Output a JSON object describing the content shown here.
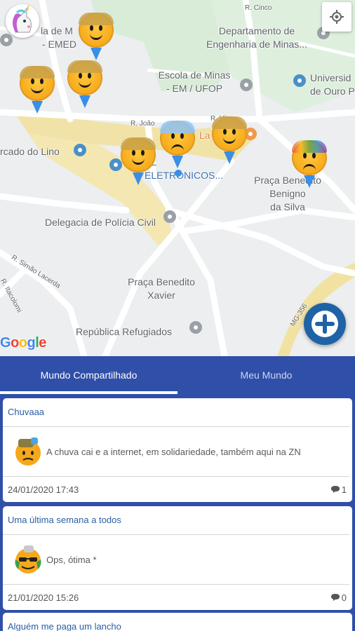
{
  "map": {
    "labels": {
      "r_cinco": "R. Cinco",
      "emed_top": "la de M",
      "emed_bottom": "- EMED",
      "departamento": "Departamento de\nEngenharia de Minas...",
      "escola": "Escola de Minas\n- EM / UFOP",
      "universidade": "Universid\nde Ouro P",
      "mercado": "rcado do Lino",
      "r_joao": "R. João",
      "r_vit": "R. Vit",
      "lanches": "La",
      "eletronicos": "AL\nELETRÔNICOS...",
      "praca_benigno": "Praça Benedito\nBenigno\nda Silva",
      "delegacia": "Delegacia de Polícia Civil",
      "r_simao": "R. Simão Lacerda",
      "r_itacolomi": "R. Itacolomi",
      "praca_xavier": "Praça Benedito\nXavier",
      "republica": "República Refugiados",
      "mg": "MG-356"
    },
    "google": "Google"
  },
  "tabs": [
    {
      "label": "Mundo Compartilhado"
    },
    {
      "label": "Meu Mundo"
    }
  ],
  "posts": [
    {
      "title": "Chuvaaa",
      "text": "A chuva cai e a internet, em solidariedade, também aqui na ZN",
      "date": "24/01/2020 17:43",
      "comments": "1"
    },
    {
      "title": "Uma última semana a todos",
      "text": "Ops, ótima *",
      "date": "21/01/2020 15:26",
      "comments": "0"
    },
    {
      "title": "Alguém me paga um lancho",
      "text": "",
      "date": "",
      "comments": ""
    }
  ],
  "colors": {
    "primary": "#2f4fa8",
    "fab": "#1f63a6",
    "marker_tip": "#3a8ee6",
    "title_blue": "#2b5fa3"
  },
  "icons": [
    "locate-icon",
    "plus-icon",
    "comment-icon",
    "unicorn-icon",
    "marker-face-icon"
  ]
}
